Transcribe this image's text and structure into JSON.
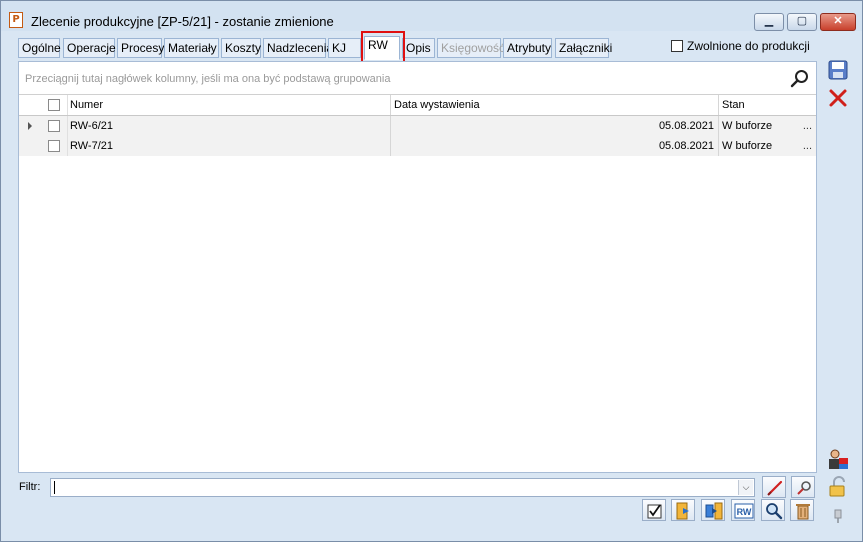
{
  "window": {
    "title": "Zlecenie produkcyjne  [ZP-5/21] - zostanie zmienione",
    "app_icon_glyph": "P",
    "min_glyph": "▁",
    "max_glyph": "▢",
    "close_glyph": "✕"
  },
  "tabs": [
    {
      "label": "Ogólne",
      "state": "normal"
    },
    {
      "label": "Operacje",
      "state": "normal"
    },
    {
      "label": "Procesy",
      "state": "normal"
    },
    {
      "label": "Materiały",
      "state": "normal"
    },
    {
      "label": "Koszty",
      "state": "normal"
    },
    {
      "label": "Nadzlecenia",
      "state": "normal"
    },
    {
      "label": "KJ",
      "state": "normal"
    },
    {
      "label": "RW",
      "state": "active"
    },
    {
      "label": "Opis",
      "state": "normal"
    },
    {
      "label": "Księgowość",
      "state": "disabled"
    },
    {
      "label": "Atrybuty",
      "state": "normal"
    },
    {
      "label": "Załączniki",
      "state": "normal"
    }
  ],
  "released_checkbox": {
    "label": "Zwolnione do produkcji",
    "checked": false
  },
  "grid": {
    "group_hint": "Przeciągnij tutaj nagłówek kolumny, jeśli ma ona być podstawą grupowania",
    "columns": {
      "numer": "Numer",
      "data": "Data wystawienia",
      "stan": "Stan"
    },
    "rows": [
      {
        "numer": "RW-6/21",
        "data": "05.08.2021",
        "stan": "W buforze",
        "more": "...",
        "current": true
      },
      {
        "numer": "RW-7/21",
        "data": "05.08.2021",
        "stan": "W buforze",
        "more": "...",
        "current": false
      }
    ]
  },
  "filter": {
    "label": "Filtr:",
    "value": "",
    "dropdown_glyph": "⌵"
  },
  "colors": {
    "accent": "#3a6fb0",
    "highlight": "#e01010",
    "window_bg": "#d9e6f3"
  },
  "icons": {
    "save": "save-icon",
    "cancel": "cancel-icon",
    "search": "search-icon",
    "clear_filter": "clear-filter-icon",
    "filter_wizard": "filter-wizard-icon",
    "check": "check-all-icon",
    "import_in": "import-icon",
    "import_out": "export-icon",
    "rw": "rw-document-icon",
    "preview": "preview-icon",
    "delete": "trash-icon",
    "user_actions": "user-actions-icon",
    "lock": "lock-icon",
    "pin": "pin-icon"
  },
  "toolbar": {
    "rw_label": "RW"
  }
}
